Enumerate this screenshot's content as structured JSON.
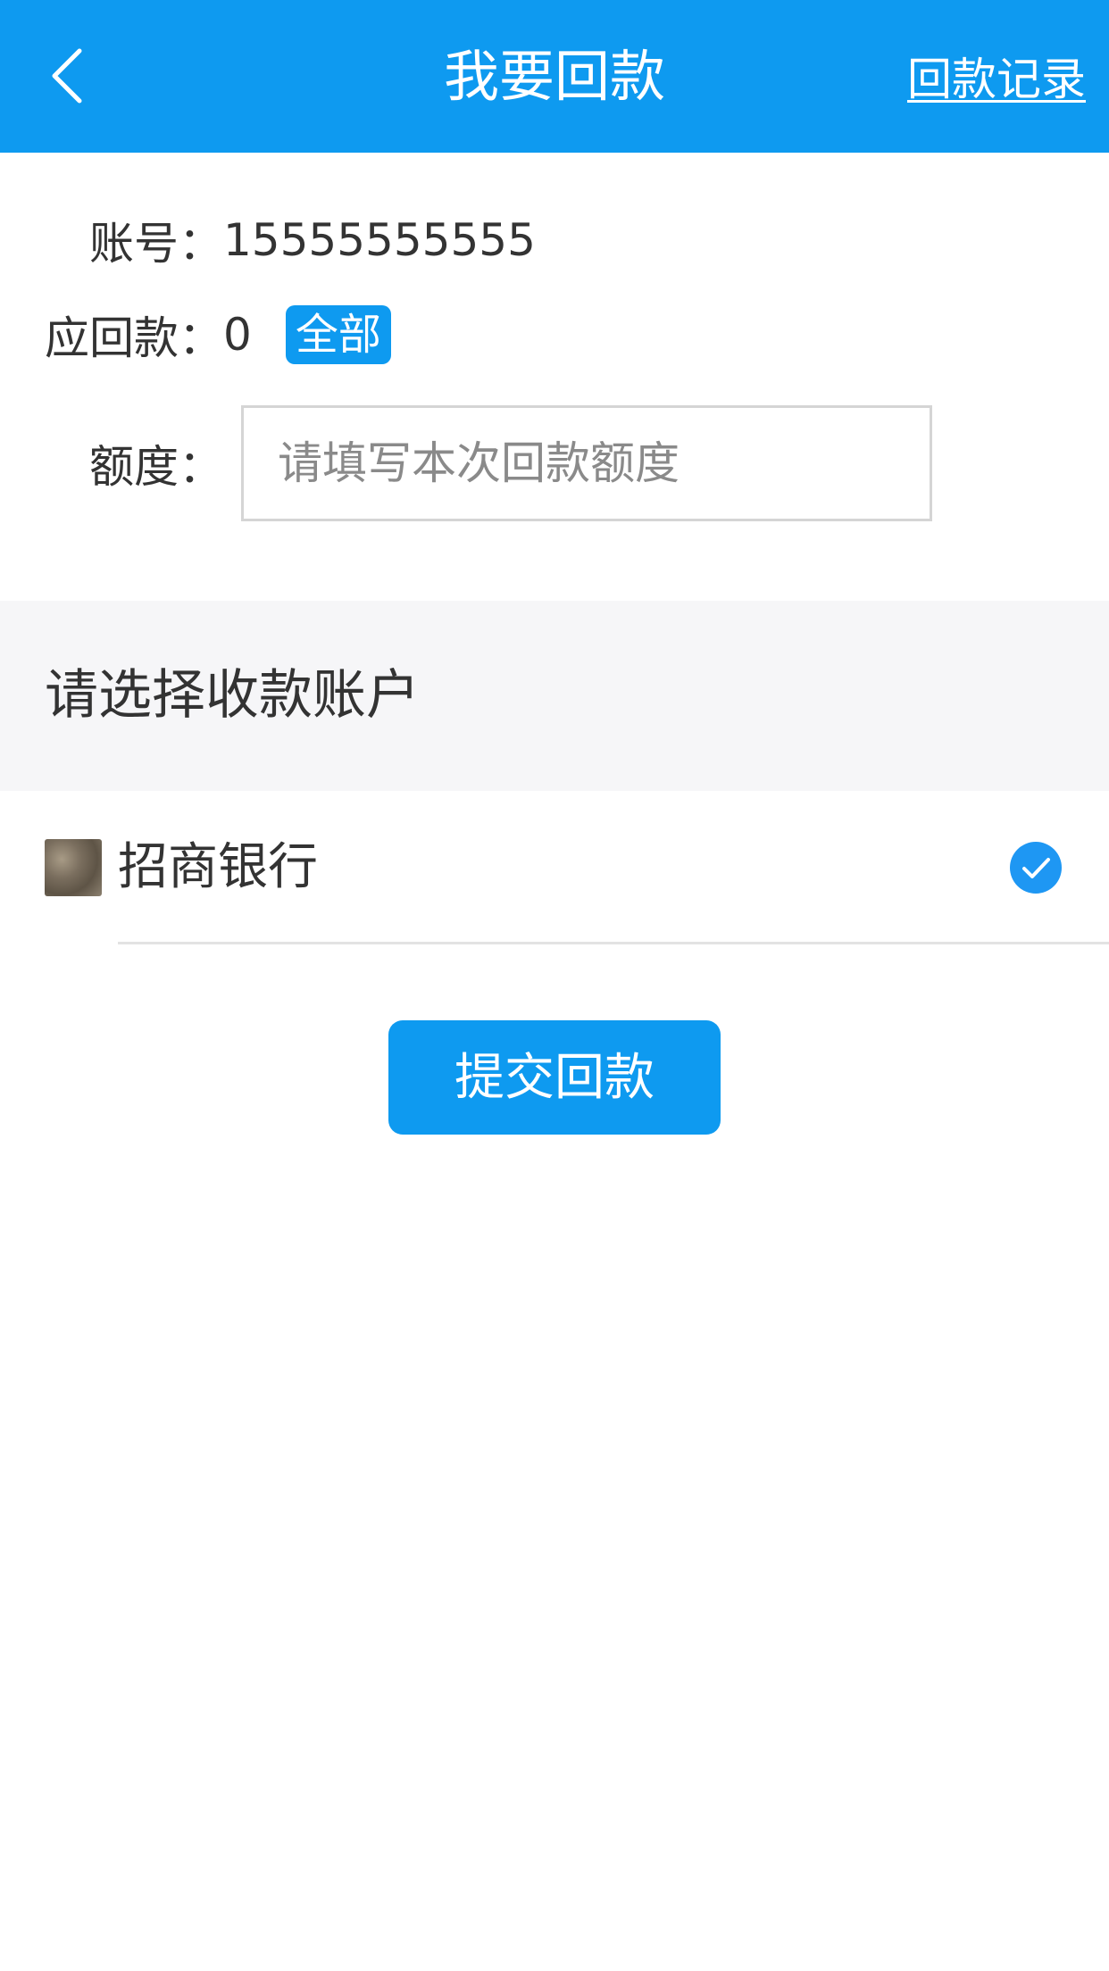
{
  "header": {
    "title": "我要回款",
    "right_link": "回款记录",
    "back_icon": "chevron-left-icon",
    "background_color": "#0e9af0"
  },
  "form": {
    "account_label": "账号：",
    "account_value": "15555555555",
    "due_label": "应回款：",
    "due_value": "0",
    "all_button": "全部",
    "amount_label": "额度：",
    "amount_value": "",
    "amount_placeholder": "请填写本次回款额度"
  },
  "section": {
    "title": "请选择收款账户"
  },
  "bank_accounts": [
    {
      "name": "招商银行",
      "logo_icon": "bank-logo-icon",
      "selected": true
    }
  ],
  "submit_button": "提交回款",
  "accent_color": "#0e9af0"
}
